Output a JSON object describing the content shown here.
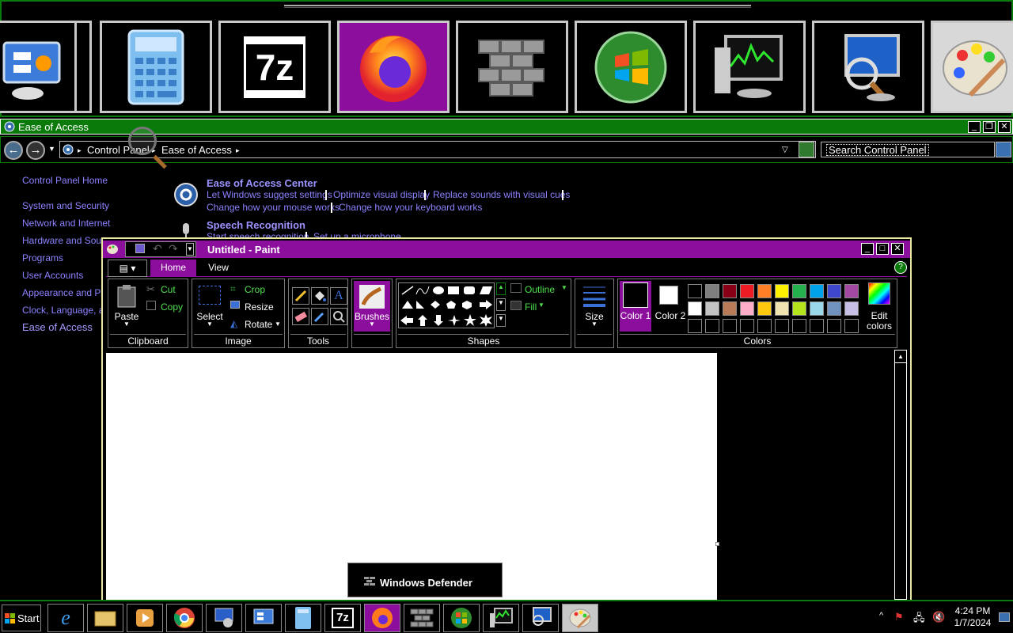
{
  "switcher": {
    "thumbnails": [
      {
        "name": "control-panel-icon"
      },
      {
        "name": "calculator-icon"
      },
      {
        "name": "7zip-icon",
        "label": "7z"
      },
      {
        "name": "firefox-icon"
      },
      {
        "name": "firewall-icon"
      },
      {
        "name": "windows-logo-icon"
      },
      {
        "name": "performance-monitor-icon"
      },
      {
        "name": "remote-desktop-icon"
      },
      {
        "name": "paint-icon"
      }
    ]
  },
  "control_panel_window": {
    "title": "Ease of Access",
    "breadcrumb": [
      "Control Panel",
      "Ease of Access"
    ],
    "search_placeholder": "Search Control Panel",
    "sidebar": [
      "Control Panel Home",
      "System and Security",
      "Network and Internet",
      "Hardware and Sound",
      "Programs",
      "User Accounts",
      "Appearance and Personalization",
      "Clock, Language, and Region",
      "Ease of Access"
    ],
    "sections": [
      {
        "title": "Ease of Access Center",
        "links": [
          "Let Windows suggest settings",
          "Optimize visual display",
          "Replace sounds with visual cues",
          "Change how your mouse works",
          "Change how your keyboard works"
        ]
      },
      {
        "title": "Speech Recognition",
        "links": [
          "Start speech recognition",
          "Set up a microphone"
        ]
      }
    ]
  },
  "paint_window": {
    "title": "Untitled - Paint",
    "tabs": [
      "Home",
      "View"
    ],
    "active_tab": "Home",
    "groups": {
      "clipboard": {
        "label": "Clipboard",
        "paste": "Paste",
        "cut": "Cut",
        "copy": "Copy"
      },
      "image": {
        "label": "Image",
        "select": "Select",
        "crop": "Crop",
        "resize": "Resize",
        "rotate": "Rotate"
      },
      "tools": {
        "label": "Tools"
      },
      "brushes": {
        "label": "Brushes"
      },
      "shapes": {
        "label": "Shapes",
        "outline": "Outline",
        "fill": "Fill"
      },
      "size": {
        "label": "Size"
      },
      "colors": {
        "label": "Colors",
        "color1": "Color 1",
        "color2": "Color 2",
        "edit": "Edit colors"
      }
    },
    "palette_row1": [
      "#000000",
      "#7f7f7f",
      "#880015",
      "#ed1c24",
      "#ff7f27",
      "#fff200",
      "#22b14c",
      "#00a2e8",
      "#3f48cc",
      "#a349a4"
    ],
    "palette_row2": [
      "#ffffff",
      "#c3c3c3",
      "#b97a57",
      "#ffaec9",
      "#ffc90e",
      "#efe4b0",
      "#b5e61d",
      "#99d9ea",
      "#7092be",
      "#c8bfe7"
    ],
    "color1": "#000000",
    "color2": "#ffffff"
  },
  "tooltip": {
    "text": "Windows Defender"
  },
  "taskbar": {
    "start_label": "Start",
    "time": "4:24 PM",
    "date": "1/7/2024"
  },
  "colors": {
    "accent_green": "#0a7a0a",
    "accent_purple": "#8b0f9c",
    "link": "#8c82ff",
    "ribbon_link": "#4fe04f"
  }
}
